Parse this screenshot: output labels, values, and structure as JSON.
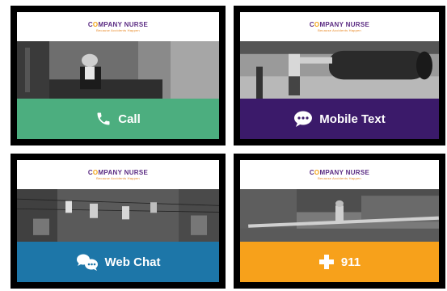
{
  "brand": {
    "name_pre": "C",
    "name_o": "O",
    "name_post": "MPANY NURSE",
    "tagline": "Because Accidents Happen"
  },
  "cards": [
    {
      "label": "Call",
      "icon": "phone-icon",
      "color": "#4cae7f"
    },
    {
      "label": "Mobile Text",
      "icon": "chat-bubble-icon",
      "color": "#3b1a6a"
    },
    {
      "label": "Web Chat",
      "icon": "chat-bubbles-icon",
      "color": "#1d76a8"
    },
    {
      "label": "911",
      "icon": "medical-cross-icon",
      "color": "#f7a11b"
    }
  ]
}
